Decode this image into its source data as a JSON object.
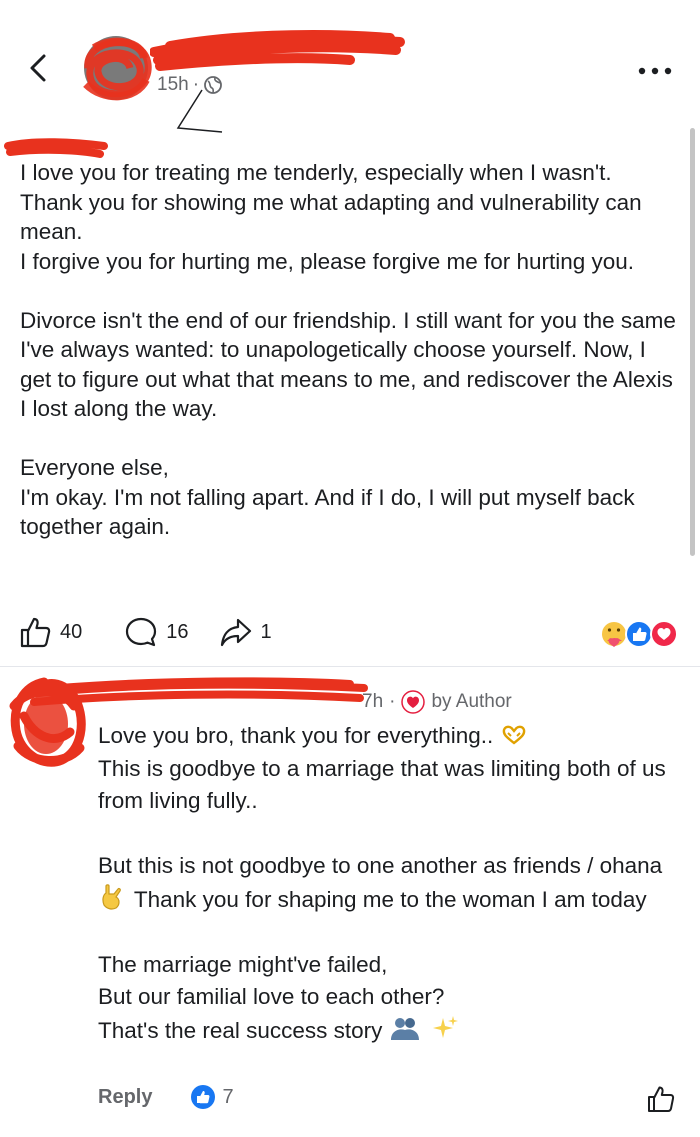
{
  "post": {
    "time": "15h",
    "lines": [
      "I love you for treating me tenderly, especially when I wasn't.",
      "Thank you for showing me what adapting and vulnerability can mean.",
      "I forgive you for hurting me, please forgive me for hurting you.",
      "",
      "Divorce isn't the end of our friendship. I still want for you the same I've always wanted: to unapologetically choose yourself. Now, I get to figure out what that means to me, and rediscover the Alexis I lost along the way.",
      "",
      "Everyone else,",
      "I'm okay. I'm not falling apart. And if I do, I will put myself back together again."
    ],
    "likes": "40",
    "comments": "16",
    "shares": "1"
  },
  "comment": {
    "time": "7h",
    "by_author": "by Author",
    "line1": "Love you bro, thank you for everything..",
    "line2": "This is goodbye to a marriage that was limiting both of us from living fully..",
    "line3a": "But this is not goodbye to one another as friends / ohana",
    "line3b": "Thank you for shaping me to the woman I am today",
    "line4": "The marriage might've failed,",
    "line5": "But our familial love to each other?",
    "line6": "That's the real success story",
    "reply_label": "Reply",
    "likes": "7"
  },
  "colors": {
    "accent": "#1877f2",
    "redact": "#e8321e",
    "muted": "#65676b"
  },
  "icons": [
    "back-arrow-icon",
    "globe-icon",
    "more-icon",
    "like-icon",
    "comment-icon",
    "share-icon",
    "heart-icon",
    "thumb-up-icon"
  ]
}
